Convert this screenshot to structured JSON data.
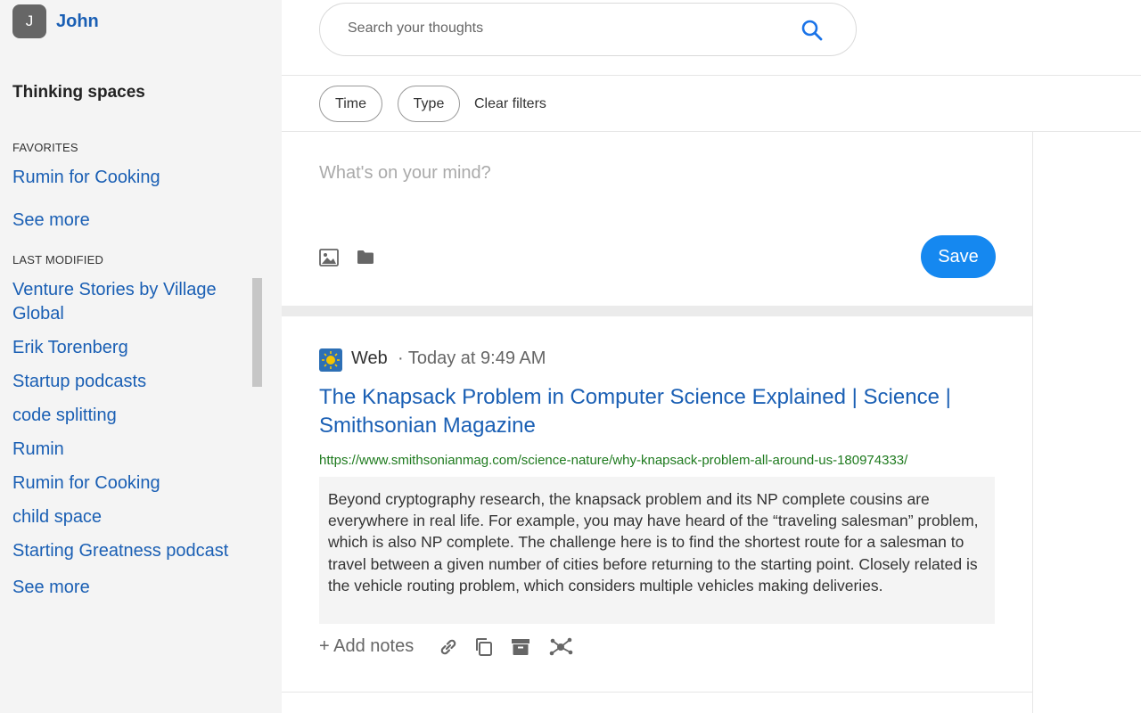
{
  "user": {
    "initial": "J",
    "name": "John"
  },
  "sidebar": {
    "title": "Thinking spaces",
    "favorites_label": "FAVORITES",
    "favorites": [
      "Rumin for Cooking"
    ],
    "favorites_see_more": "See more",
    "last_modified_label": "LAST MODIFIED",
    "last_modified": [
      "Venture Stories by Village Global",
      "Erik Torenberg",
      "Startup podcasts",
      "code splitting",
      "Rumin",
      "Rumin for Cooking",
      "child space",
      "Starting Greatness podcast"
    ],
    "last_modified_see_more": "See more"
  },
  "search": {
    "placeholder": "Search your thoughts"
  },
  "filters": {
    "time": "Time",
    "type": "Type",
    "clear": "Clear filters"
  },
  "composer": {
    "placeholder": "What's on your mind?",
    "save_label": "Save"
  },
  "card": {
    "source": "Web",
    "time": "· Today at 9:49 AM",
    "title": "The Knapsack Problem in Computer Science Explained | Science | Smithsonian Magazine",
    "url": "https://www.smithsonianmag.com/science-nature/why-knapsack-problem-all-around-us-180974333/",
    "quote": "Beyond cryptography research, the knapsack problem and its NP complete cousins are everywhere in real life. For example, you may have heard of the “traveling salesman” problem, which is also NP complete. The challenge here is to find the shortest route for a salesman to travel between a given number of cities before returning to the starting point. Closely related is the vehicle routing problem, which considers multiple vehicles making deliveries.",
    "add_notes": "+ Add notes"
  },
  "colors": {
    "accent": "#1588f0",
    "link": "#1a5fb4",
    "url": "#1e7a1e"
  }
}
